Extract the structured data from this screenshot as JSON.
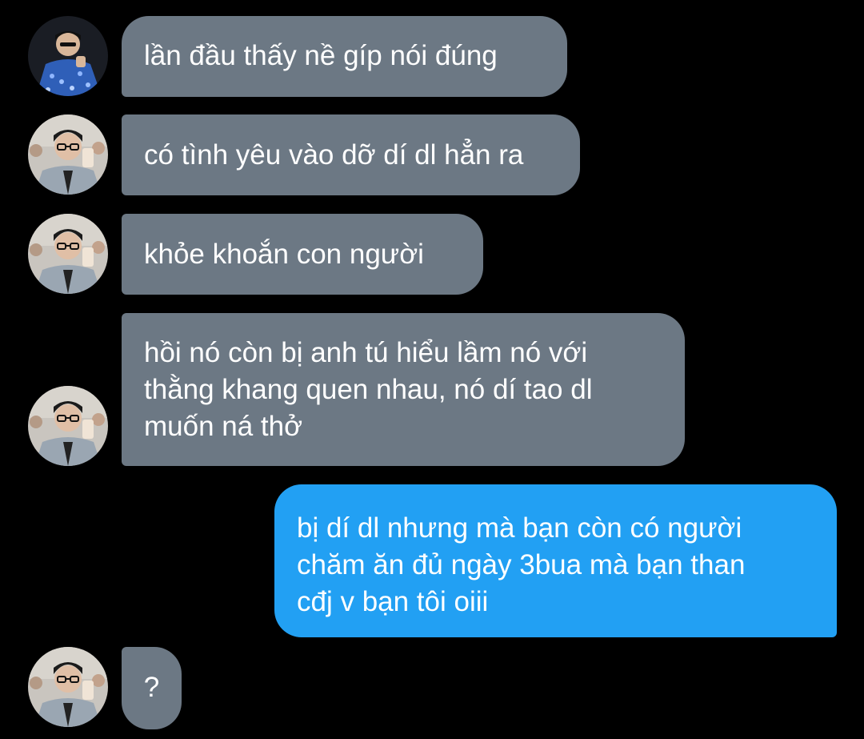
{
  "colors": {
    "background": "#000000",
    "received_bubble": "#6c7884",
    "sent_bubble": "#22a0f3",
    "text": "#ffffff"
  },
  "messages": [
    {
      "sender": "other",
      "avatar": "avatar-sequin-jacket-photo",
      "lines": [
        "lần đầu thấy nề gíp nói đúng"
      ]
    },
    {
      "sender": "other",
      "avatar": "avatar-glasses-selfie-photo",
      "lines": [
        "có tình yêu vào dỡ dí dl hẳn ra"
      ]
    },
    {
      "sender": "other",
      "avatar": "avatar-glasses-selfie-photo",
      "lines": [
        "khỏe khoắn con người"
      ]
    },
    {
      "sender": "other",
      "avatar": "avatar-glasses-selfie-photo",
      "lines": [
        "hồi nó còn bị anh tú hiểu lầm nó với",
        "thằng khang quen nhau, nó dí tao dl",
        "muốn ná thở"
      ]
    },
    {
      "sender": "me",
      "lines": [
        "bị dí dl nhưng mà bạn còn có người",
        "chăm ăn đủ ngày 3bua mà bạn than",
        "cđj v bạn tôi oiii"
      ]
    },
    {
      "sender": "other",
      "avatar": "avatar-glasses-selfie-photo",
      "lines": [
        "?"
      ]
    }
  ]
}
